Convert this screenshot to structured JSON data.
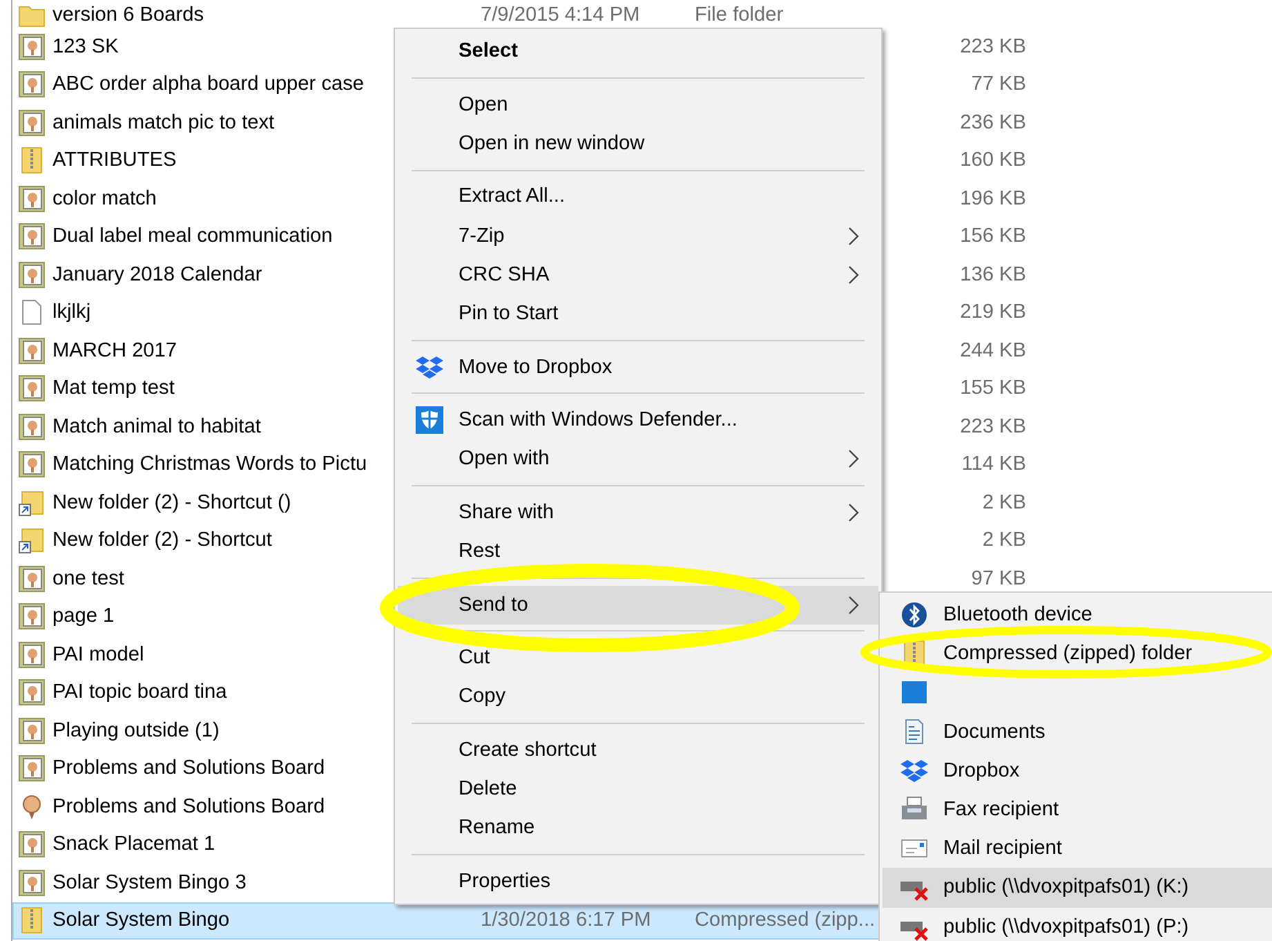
{
  "file_list": {
    "rows": [
      {
        "name": "version 6 Boards",
        "kind": "folder",
        "date": "7/9/2015 4:14 PM",
        "type": "File folder",
        "selected": false
      },
      {
        "name": "123 SK",
        "kind": "board",
        "size": "223 KB",
        "selected": false
      },
      {
        "name": "ABC order alpha board upper case",
        "kind": "board",
        "size": "77 KB",
        "selected": false
      },
      {
        "name": "animals match pic to text",
        "kind": "board",
        "size": "236 KB",
        "selected": false
      },
      {
        "name": "ATTRIBUTES",
        "kind": "zip",
        "size": "160 KB",
        "selected": false
      },
      {
        "name": "color match",
        "kind": "board",
        "size": "196 KB",
        "selected": false
      },
      {
        "name": "Dual label meal communication",
        "kind": "board",
        "size": "156 KB",
        "selected": false
      },
      {
        "name": "January 2018 Calendar",
        "kind": "board",
        "size": "136 KB",
        "selected": false
      },
      {
        "name": "lkjlkj",
        "kind": "doc",
        "size": "219 KB",
        "selected": false
      },
      {
        "name": "MARCH 2017",
        "kind": "board",
        "size": "244 KB",
        "selected": false
      },
      {
        "name": "Mat temp test",
        "kind": "board",
        "size": "155 KB",
        "selected": false
      },
      {
        "name": "Match animal to habitat",
        "kind": "board",
        "size": "223 KB",
        "selected": false
      },
      {
        "name": "Matching Christmas Words to Pictu",
        "kind": "board",
        "size": "114 KB",
        "selected": false
      },
      {
        "name": "New folder (2) - Shortcut ()",
        "kind": "shortcut",
        "size": "2 KB",
        "selected": false
      },
      {
        "name": "New folder (2) - Shortcut",
        "kind": "shortcut",
        "size": "2 KB",
        "selected": false
      },
      {
        "name": "one test",
        "kind": "board",
        "size": "97 KB",
        "selected": false
      },
      {
        "name": "page 1",
        "kind": "board",
        "selected": false
      },
      {
        "name": "PAI model",
        "kind": "board",
        "selected": false
      },
      {
        "name": "PAI topic board tina",
        "kind": "board",
        "selected": false
      },
      {
        "name": "Playing outside (1)",
        "kind": "board",
        "selected": false
      },
      {
        "name": "Problems and Solutions Board",
        "kind": "board",
        "selected": false
      },
      {
        "name": "Problems and Solutions Board",
        "kind": "figure",
        "selected": false
      },
      {
        "name": "Snack Placemat 1",
        "kind": "board",
        "selected": false
      },
      {
        "name": "Solar System Bingo 3",
        "kind": "board",
        "selected": false
      },
      {
        "name": "Solar System Bingo",
        "kind": "zip",
        "date": "1/30/2018 6:17 PM",
        "type": "Compressed (zipp...",
        "selected": true
      }
    ]
  },
  "context_menu": {
    "items": [
      {
        "kind": "plain",
        "label": "Select",
        "bold": true,
        "submenu": false,
        "selected": false
      },
      {
        "kind": "separator"
      },
      {
        "kind": "plain",
        "label": "Open",
        "bold": false,
        "submenu": false,
        "selected": false
      },
      {
        "kind": "plain",
        "label": "Open in new window",
        "bold": false,
        "submenu": false,
        "selected": false
      },
      {
        "kind": "separator"
      },
      {
        "kind": "plain",
        "label": "Extract All...",
        "bold": false,
        "submenu": false,
        "selected": false
      },
      {
        "kind": "plain",
        "label": "7-Zip",
        "bold": false,
        "submenu": true,
        "selected": false
      },
      {
        "kind": "plain",
        "label": "CRC SHA",
        "bold": false,
        "submenu": true,
        "selected": false
      },
      {
        "kind": "plain",
        "label": "Pin to Start",
        "bold": false,
        "submenu": false,
        "selected": false
      },
      {
        "kind": "separator"
      },
      {
        "kind": "dropbox",
        "label": "Move to Dropbox",
        "bold": false,
        "submenu": false,
        "selected": false
      },
      {
        "kind": "separator"
      },
      {
        "kind": "defender",
        "label": "Scan with Windows Defender...",
        "bold": false,
        "submenu": false,
        "selected": false
      },
      {
        "kind": "plain",
        "label": "Open with",
        "bold": false,
        "submenu": true,
        "selected": false
      },
      {
        "kind": "separator"
      },
      {
        "kind": "plain",
        "label": "Share with",
        "bold": false,
        "submenu": true,
        "selected": false
      },
      {
        "kind": "plain",
        "label": "Rest",
        "bold": false,
        "submenu": false,
        "selected": false
      },
      {
        "kind": "separator"
      },
      {
        "kind": "plain",
        "label": "Send to",
        "bold": false,
        "submenu": true,
        "selected": true
      },
      {
        "kind": "separator"
      },
      {
        "kind": "plain",
        "label": "Cut",
        "bold": false,
        "submenu": false,
        "selected": false
      },
      {
        "kind": "plain",
        "label": "Copy",
        "bold": false,
        "submenu": false,
        "selected": false
      },
      {
        "kind": "separator"
      },
      {
        "kind": "plain",
        "label": "Create shortcut",
        "bold": false,
        "submenu": false,
        "selected": false
      },
      {
        "kind": "plain",
        "label": "Delete",
        "bold": false,
        "submenu": false,
        "selected": false
      },
      {
        "kind": "plain",
        "label": "Rename",
        "bold": false,
        "submenu": false,
        "selected": false
      },
      {
        "kind": "separator"
      },
      {
        "kind": "plain",
        "label": "Properties",
        "bold": false,
        "submenu": false,
        "selected": false
      }
    ]
  },
  "send_to_menu": {
    "items": [
      {
        "kind": "bluetooth",
        "label": "Bluetooth device",
        "selected": false
      },
      {
        "kind": "zip",
        "label": "Compressed (zipped) folder",
        "selected": false
      },
      {
        "kind": "desktop",
        "selected": false
      },
      {
        "kind": "documents",
        "label": "Documents",
        "selected": false
      },
      {
        "kind": "dropbox",
        "label": "Dropbox",
        "selected": false
      },
      {
        "kind": "fax",
        "label": "Fax recipient",
        "selected": false
      },
      {
        "kind": "mail",
        "label": "Mail recipient",
        "selected": false
      },
      {
        "kind": "drive",
        "label": "public (\\\\dvoxpitpafs01) (K:)",
        "selected": true
      },
      {
        "kind": "drive",
        "label": "public (\\\\dvoxpitpafs01) (P:)",
        "selected": false
      }
    ]
  },
  "annotations": [
    {
      "kind": "ellipse"
    },
    {
      "kind": "ellipse"
    }
  ]
}
